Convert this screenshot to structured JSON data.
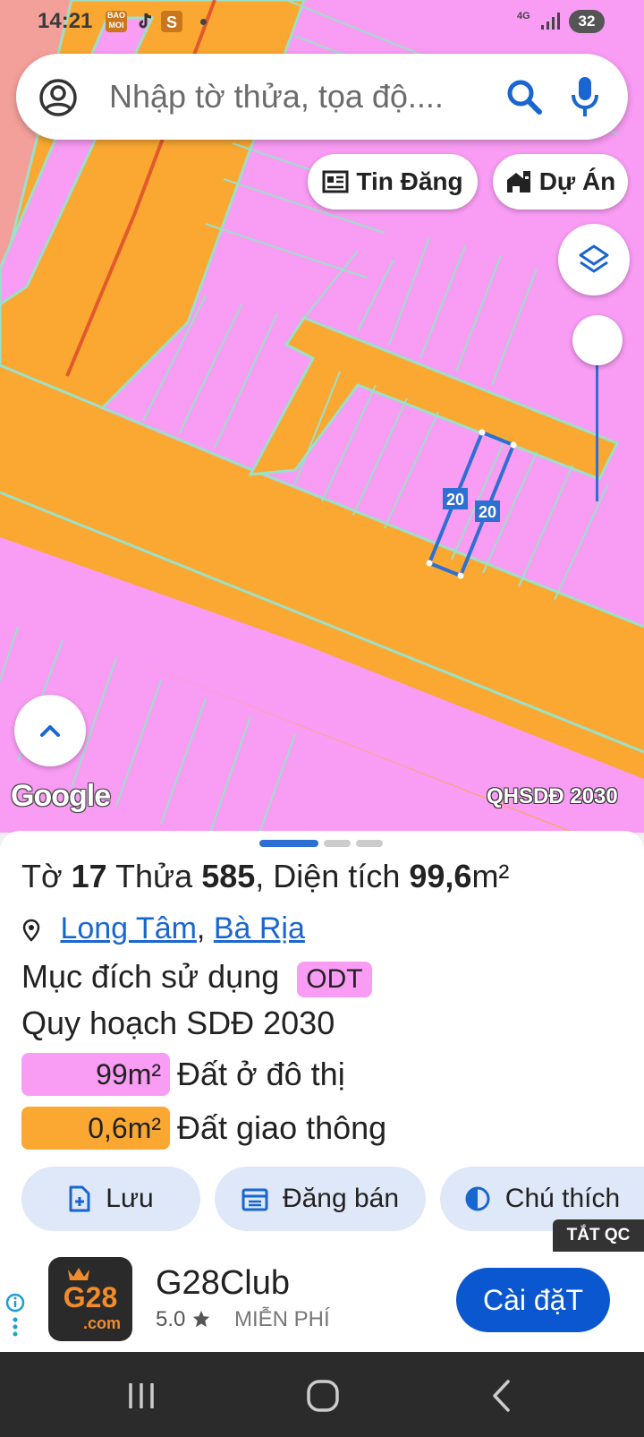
{
  "status_bar": {
    "time": "14:21",
    "app_icons": [
      "baomoi-icon",
      "tiktok-icon",
      "shopee-icon"
    ],
    "network": "4G",
    "battery": "32"
  },
  "search": {
    "placeholder": "Nhập tờ thửa, tọa độ...."
  },
  "map": {
    "chips": [
      {
        "label": "Tin Đăng",
        "icon": "newspaper-icon"
      },
      {
        "label": "Dự Án",
        "icon": "building-icon"
      }
    ],
    "parcel_edge_labels": [
      "20",
      "20"
    ],
    "brand": "Google",
    "plan_label": "QHSDĐ 2030",
    "colors": {
      "residential": "#f99cf4",
      "traffic": "#fba832",
      "parcel_outline": "#2d6fd2"
    }
  },
  "parcel": {
    "sheet_prefix": "Tờ",
    "sheet_no": "17",
    "lot_prefix": "Thửa",
    "lot_no": "585",
    "area_prefix": ", Diện tích",
    "area_value": "99,6",
    "area_unit": "m²",
    "location": {
      "ward": "Long Tâm",
      "separator": ",",
      "city": "Bà Rịa"
    },
    "purpose_label": "Mục đích sử dụng",
    "purpose_code": "ODT",
    "plan_title": "Quy hoạch SDĐ 2030",
    "breakdown": [
      {
        "area": "99m²",
        "label": "Đất ở đô thị",
        "color": "#f99cf4"
      },
      {
        "area": "0,6m²",
        "label": "Đất giao thông",
        "color": "#fba832"
      }
    ]
  },
  "actions": [
    {
      "label": "Lưu",
      "icon": "save-file-icon"
    },
    {
      "label": "Đăng bán",
      "icon": "calendar-icon"
    },
    {
      "label": "Chú thích",
      "icon": "contrast-icon"
    }
  ],
  "ad": {
    "close_label": "TẮT QC",
    "logo_text": "G28",
    "logo_sub": ".com",
    "app_name": "G28Club",
    "rating": "5.0",
    "price": "MIỄN PHÍ",
    "install_label": "Cài đặT"
  }
}
